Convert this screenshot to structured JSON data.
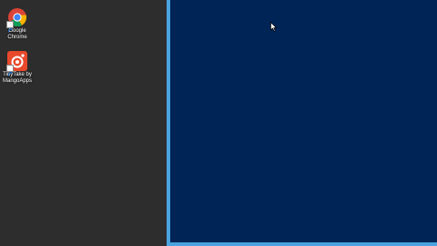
{
  "desktop": {
    "icons": [
      {
        "label": "Google\nChrome",
        "icon": "chrome-icon"
      },
      {
        "label": "TinyTake by\nMangoApps",
        "icon": "tinytake-icon"
      }
    ]
  },
  "colors": {
    "desktop_bg": "#2d2d2d",
    "window_bg": "#012456",
    "window_border": "#4aa3df"
  }
}
